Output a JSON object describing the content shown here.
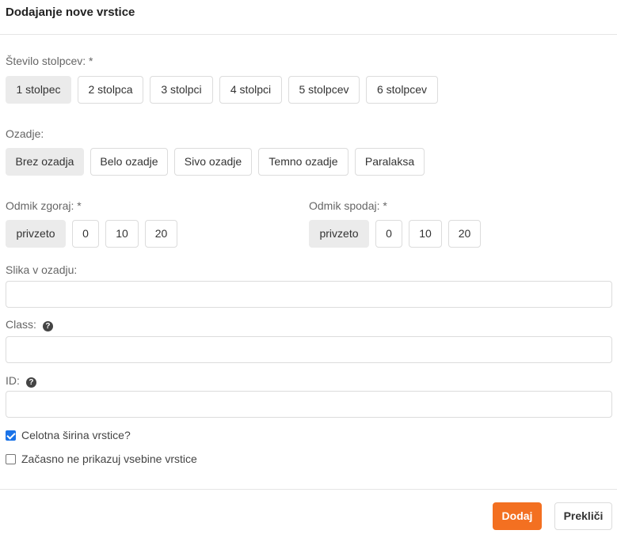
{
  "modal": {
    "title": "Dodajanje nove vrstice"
  },
  "columns": {
    "label": "Število stolpcev: *",
    "options": [
      "1 stolpec",
      "2 stolpca",
      "3 stolpci",
      "4 stolpci",
      "5 stolpcev",
      "6 stolpcev"
    ],
    "selected": "1 stolpec"
  },
  "background": {
    "label": "Ozadje:",
    "options": [
      "Brez ozadja",
      "Belo ozadje",
      "Sivo ozadje",
      "Temno ozadje",
      "Paralaksa"
    ],
    "selected": "Brez ozadja"
  },
  "margin_top": {
    "label": "Odmik zgoraj: *",
    "options": [
      "privzeto",
      "0",
      "10",
      "20"
    ],
    "selected": "privzeto"
  },
  "margin_bottom": {
    "label": "Odmik spodaj: *",
    "options": [
      "privzeto",
      "0",
      "10",
      "20"
    ],
    "selected": "privzeto"
  },
  "bg_image": {
    "label": "Slika v ozadju:",
    "value": ""
  },
  "css_class": {
    "label": "Class:",
    "value": "",
    "help_icon": "question-circle-icon"
  },
  "element_id": {
    "label": "ID:",
    "value": "",
    "help_icon": "question-circle-icon"
  },
  "full_width": {
    "label": "Celotna širina vrstice?",
    "checked": true
  },
  "hide_content": {
    "label": "Začasno ne prikazuj vsebine vrstice",
    "checked": false
  },
  "footer": {
    "add_label": "Dodaj",
    "cancel_label": "Prekliči"
  },
  "colors": {
    "primary": "#f37021",
    "selected_option_bg": "#ebebeb",
    "checkbox_checked": "#1a73e8"
  }
}
